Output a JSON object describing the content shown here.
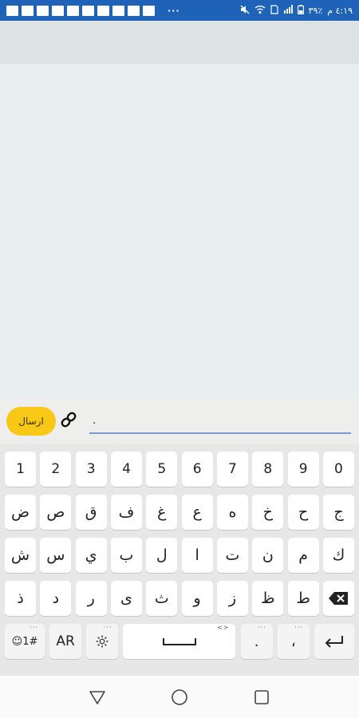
{
  "status_bar": {
    "time": "٤:١٩ م",
    "battery": "٣٩٪",
    "more": "···"
  },
  "composer": {
    "send_label": "ارسال",
    "input_value": "."
  },
  "keyboard": {
    "number_row": [
      "1",
      "2",
      "3",
      "4",
      "5",
      "6",
      "7",
      "8",
      "9",
      "0"
    ],
    "row1": [
      "ض",
      "ص",
      "ق",
      "ف",
      "غ",
      "ع",
      "ه",
      "خ",
      "ح",
      "ج"
    ],
    "row2": [
      "ش",
      "س",
      "ي",
      "ب",
      "ل",
      "ا",
      "ت",
      "ن",
      "م",
      "ك"
    ],
    "row3": [
      "ذ",
      "د",
      "ر",
      "ى",
      "ث",
      "و",
      "ز",
      "ظ",
      "ط"
    ],
    "symbols_label": "☺1#",
    "language_label": "AR",
    "period_label": ".",
    "comma_label": "،"
  },
  "colors": {
    "status_bar": "#1e63b8",
    "send_button": "#f7c916",
    "input_underline": "#7a9bd0"
  }
}
